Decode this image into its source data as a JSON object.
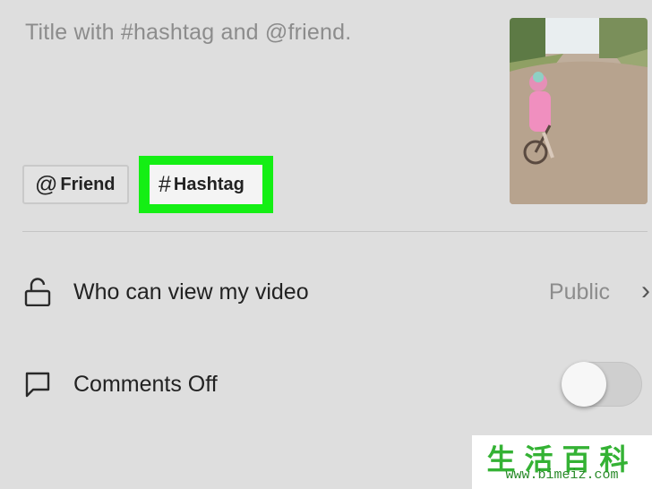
{
  "post": {
    "caption_placeholder": "Title with #hashtag and @friend."
  },
  "chips": {
    "friend_glyph": "@",
    "friend_label": "Friend",
    "hashtag_glyph": "#",
    "hashtag_label": "Hashtag",
    "highlight_color": "#14ef14"
  },
  "settings": {
    "privacy": {
      "icon": "unlock-icon",
      "label": "Who can view my video",
      "value": "Public",
      "chevron": "›"
    },
    "comments": {
      "icon": "comment-icon",
      "label": "Comments Off",
      "toggle_on": false
    }
  },
  "watermark": {
    "chars": "生活百科",
    "url": "www.bimeiz.com"
  }
}
